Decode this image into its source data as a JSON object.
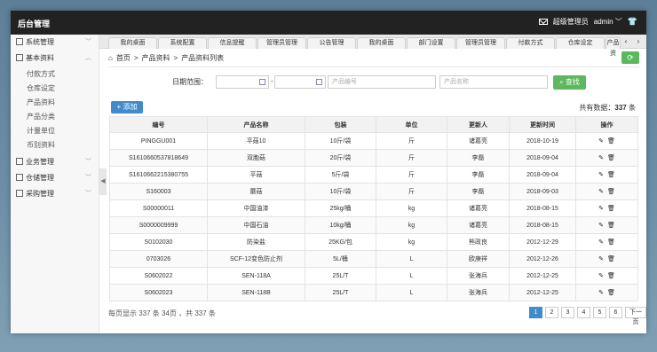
{
  "app": {
    "title": "后台管理",
    "user_role": "超级管理员",
    "user_name": "admin"
  },
  "sidebar": {
    "groups": [
      {
        "label": "系统管理"
      },
      {
        "label": "基本资料",
        "items": [
          "付款方式",
          "仓库设定",
          "产品资料",
          "产品分类",
          "计量单位",
          "币别资料"
        ]
      },
      {
        "label": "业务管理"
      },
      {
        "label": "仓储管理"
      },
      {
        "label": "采购管理"
      }
    ]
  },
  "tabs": [
    "我的桌面",
    "系统配置",
    "信息提醒",
    "管理员管理",
    "公告管理",
    "我的桌面",
    "部门设置",
    "管理员管理",
    "付款方式",
    "仓库设定",
    "产品资"
  ],
  "breadcrumb": [
    "首页",
    "产品资料",
    "产品资料列表"
  ],
  "filter": {
    "date_label": "日期范围：",
    "dash": "-",
    "product_no_placeholder": "产品编号",
    "product_name_placeholder": "产品名称",
    "search_label": "查找"
  },
  "toolbar": {
    "add_label": "添加",
    "total_prefix": "共有数据：",
    "total_count": "337",
    "total_suffix": "条"
  },
  "table": {
    "headers": [
      "编号",
      "产品名称",
      "包装",
      "单位",
      "更新人",
      "更新时间",
      "操作"
    ],
    "rows": [
      [
        "PINGGU001",
        "平菇10",
        "10斤/袋",
        "斤",
        "诸葛亮",
        "2018-10-19"
      ],
      [
        "S1610660537818649",
        "双胞菇",
        "20斤/袋",
        "斤",
        "李磊",
        "2018-09-04"
      ],
      [
        "S1610662215380755",
        "平菇",
        "5斤/袋",
        "斤",
        "李磊",
        "2018-09-04"
      ],
      [
        "S160003",
        "蘑菇",
        "10斤/袋",
        "斤",
        "李磊",
        "2018-09-03"
      ],
      [
        "S00000011",
        "中国油漆",
        "25kg/桶",
        "kg",
        "诸葛亮",
        "2018-08-15"
      ],
      [
        "S0000009999",
        "中国石油",
        "10kg/桶",
        "kg",
        "诸葛亮",
        "2018-08-15"
      ],
      [
        "S0102030",
        "防染盐",
        "25KG/包",
        "kg",
        "熊政良",
        "2012-12-29"
      ],
      [
        "0703026",
        "SCF-12变色防止剂",
        "5L/桶",
        "L",
        "欧庚祥",
        "2012-12-26"
      ],
      [
        "S0602022",
        "SEN-118A",
        "25L/T",
        "L",
        "张海兵",
        "2012-12-25"
      ],
      [
        "S0602023",
        "SEN-118B",
        "25L/T",
        "L",
        "张海兵",
        "2012-12-25"
      ]
    ]
  },
  "pagination": {
    "info": "每页显示 337 条 34页 ，共 337 条",
    "pages": [
      "1",
      "2",
      "3",
      "4",
      "5",
      "6"
    ],
    "next_label": "下一页",
    "current": "1"
  }
}
